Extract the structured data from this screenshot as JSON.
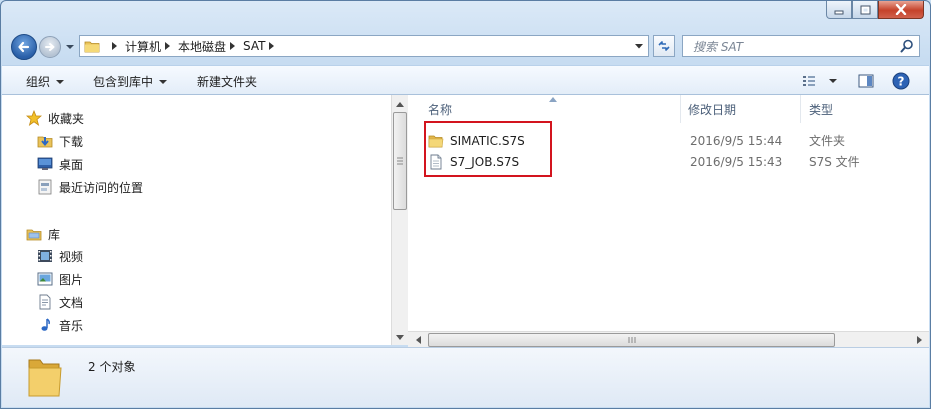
{
  "window": {
    "caption_buttons": [
      "minimize-icon",
      "maximize-icon",
      "close-icon"
    ]
  },
  "address_bar": {
    "breadcrumbs": [
      "计算机",
      "本地磁盘",
      "SAT"
    ],
    "dropdown_icon": "chevron-down-icon",
    "refresh_icon": "refresh-icon"
  },
  "search": {
    "placeholder": "搜索 SAT",
    "icon": "search-icon"
  },
  "toolbar": {
    "organize_label": "组织",
    "include_library_label": "包含到库中",
    "new_folder_label": "新建文件夹",
    "right_icons": [
      "view-options-icon",
      "preview-pane-icon",
      "help-icon"
    ]
  },
  "navigation": {
    "favorites": {
      "label": "收藏夹",
      "icon": "star-icon",
      "items": [
        {
          "label": "下载",
          "icon": "downloads-icon"
        },
        {
          "label": "桌面",
          "icon": "desktop-icon"
        },
        {
          "label": "最近访问的位置",
          "icon": "recent-places-icon"
        }
      ]
    },
    "libraries": {
      "label": "库",
      "icon": "library-icon",
      "items": [
        {
          "label": "视频",
          "icon": "video-icon"
        },
        {
          "label": "图片",
          "icon": "pictures-icon"
        },
        {
          "label": "文档",
          "icon": "documents-icon"
        },
        {
          "label": "音乐",
          "icon": "music-icon"
        }
      ]
    }
  },
  "file_list": {
    "columns": {
      "name": "名称",
      "date": "修改日期",
      "type": "类型"
    },
    "files": [
      {
        "name": "SIMATIC.S7S",
        "date": "2016/9/5 15:44",
        "type": "文件夹",
        "icon": "folder-icon"
      },
      {
        "name": "S7_JOB.S7S",
        "date": "2016/9/5 15:43",
        "type": "S7S 文件",
        "icon": "file-icon"
      }
    ],
    "highlight_color": "#d3141e"
  },
  "details_pane": {
    "count_text": "2 个对象",
    "icon": "folder-large-icon"
  },
  "colors": {
    "frame": "#c7dcf1",
    "accent": "#2a5fa8"
  }
}
